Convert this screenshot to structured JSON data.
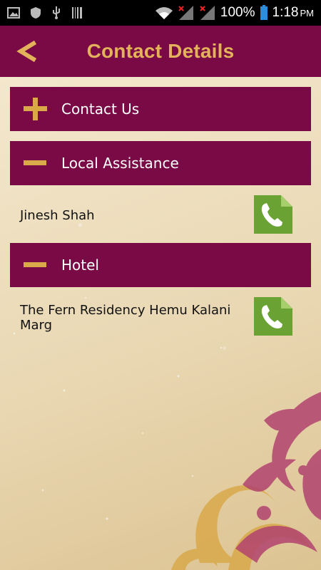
{
  "status_bar": {
    "battery_text": "100%",
    "time": "1:18",
    "ampm": "PM"
  },
  "header": {
    "title": "Contact Details",
    "back_label": "<"
  },
  "sections": [
    {
      "label": "Contact Us",
      "state": "collapsed",
      "icon": "plus-icon"
    },
    {
      "label": "Local Assistance",
      "state": "expanded",
      "icon": "minus-icon",
      "contacts": [
        {
          "name": "Jinesh Shah"
        }
      ]
    },
    {
      "label": "Hotel",
      "state": "expanded",
      "icon": "minus-icon",
      "contacts": [
        {
          "name": "The Fern Residency Hemu Kalani Marg"
        }
      ]
    }
  ],
  "colors": {
    "brand": "#7a0a46",
    "accent_gold": "#e3b25a",
    "call_green": "#6aa234"
  }
}
